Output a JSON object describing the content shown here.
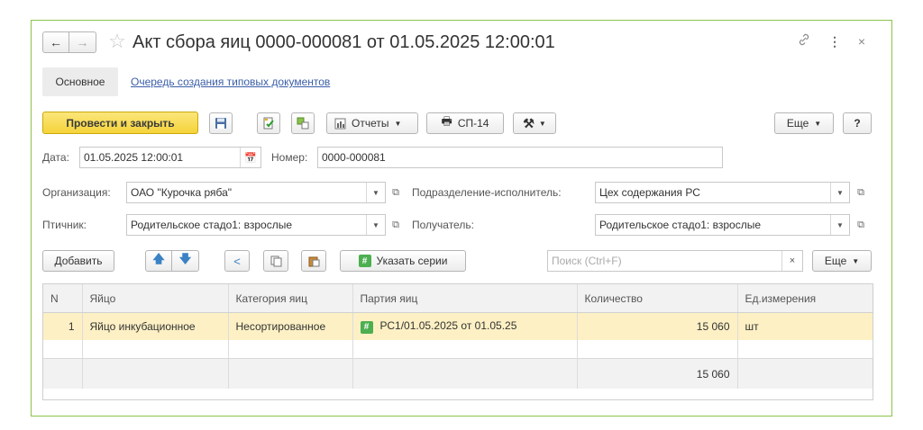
{
  "window": {
    "title": "Акт сбора яиц 0000-000081 от 01.05.2025 12:00:01"
  },
  "tabs": [
    {
      "label": "Основное",
      "active": true
    },
    {
      "label": "Очередь создания типовых документов",
      "active": false
    }
  ],
  "toolbar": {
    "post_close": "Провести и закрыть",
    "reports": "Отчеты",
    "sp14": "СП-14",
    "more": "Еще",
    "help": "?"
  },
  "form": {
    "date_label": "Дата:",
    "date_value": "01.05.2025 12:00:01",
    "number_label": "Номер:",
    "number_value": "0000-000081",
    "org_label": "Организация:",
    "org_value": "ОАО \"Курочка ряба\"",
    "dept_label": "Подразделение-исполнитель:",
    "dept_value": "Цех содержания РС",
    "worker_label": "Птичник:",
    "worker_value": "Родительское стадо1: взрослые",
    "recipient_label": "Получатель:",
    "recipient_value": "Родительское стадо1: взрослые"
  },
  "table_toolbar": {
    "add": "Добавить",
    "series": "Указать серии",
    "search_placeholder": "Поиск (Ctrl+F)",
    "more": "Еще"
  },
  "table": {
    "columns": [
      "N",
      "Яйцо",
      "Категория яиц",
      "Партия яиц",
      "Количество",
      "Ед.измерения"
    ],
    "rows": [
      {
        "n": "1",
        "egg": "Яйцо инкубационное",
        "category": "Несортированное",
        "batch": "РС1/01.05.2025 от 01.05.25",
        "qty": "15 060",
        "unit": "шт"
      }
    ],
    "total_qty": "15 060"
  },
  "colors": {
    "frame_border": "#8bc34a",
    "primary_button": "#f5d33a",
    "selected_row": "#fdf0c4",
    "link": "#3a5ea8"
  }
}
